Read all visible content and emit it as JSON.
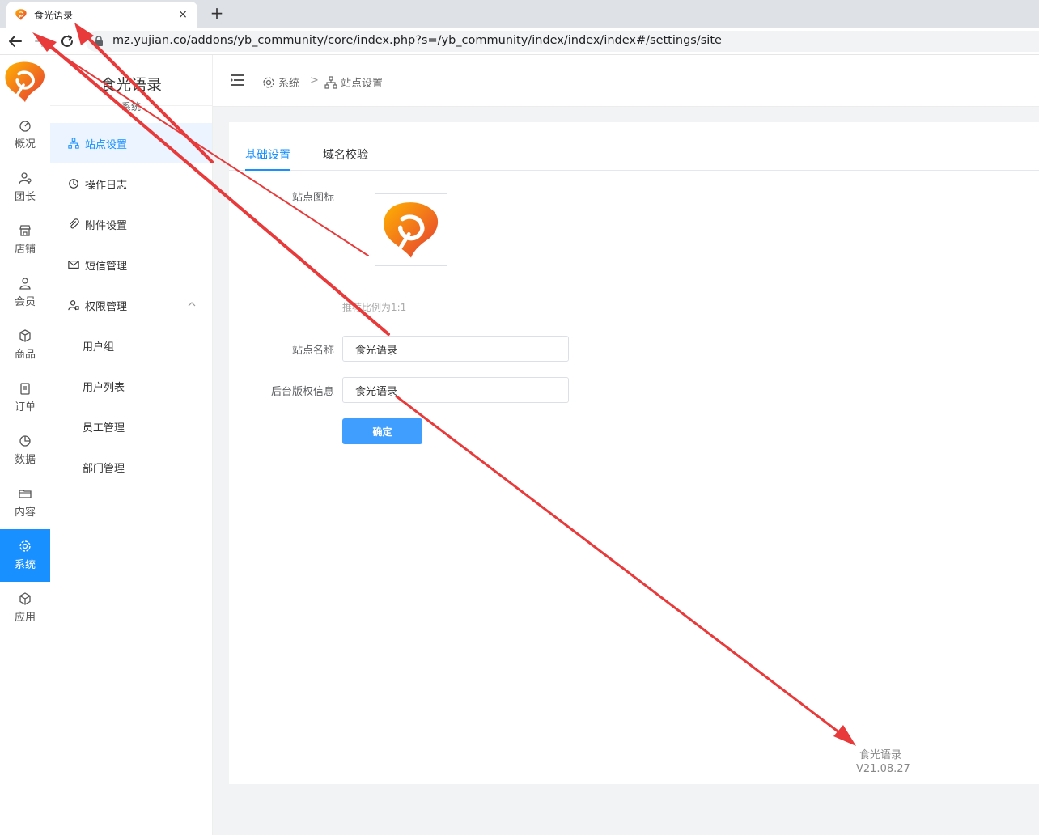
{
  "browser": {
    "tab_title": "食光语录",
    "new_tab": "+",
    "close": "×",
    "url": "mz.yujian.co/addons/yb_community/core/index.php?s=/yb_community/index/index/index#/settings/site"
  },
  "rail": {
    "items": [
      {
        "label": "概况",
        "icon": "dashboard-icon"
      },
      {
        "label": "团长",
        "icon": "user-star-icon"
      },
      {
        "label": "店铺",
        "icon": "shop-icon"
      },
      {
        "label": "会员",
        "icon": "user-icon"
      },
      {
        "label": "商品",
        "icon": "box-icon"
      },
      {
        "label": "订单",
        "icon": "clipboard-icon"
      },
      {
        "label": "数据",
        "icon": "pie-chart-icon"
      },
      {
        "label": "内容",
        "icon": "folder-icon"
      },
      {
        "label": "系统",
        "icon": "gear-icon",
        "active": true
      },
      {
        "label": "应用",
        "icon": "cube-icon"
      }
    ]
  },
  "submenu": {
    "title": "食光语录",
    "subtitle": "系统",
    "items": [
      {
        "label": "站点设置",
        "icon": "sitemap-icon",
        "active": true
      },
      {
        "label": "操作日志",
        "icon": "history-icon"
      },
      {
        "label": "附件设置",
        "icon": "paperclip-icon"
      },
      {
        "label": "短信管理",
        "icon": "mail-icon"
      },
      {
        "label": "权限管理",
        "icon": "user-lock-icon",
        "expanded": true
      }
    ],
    "children": [
      "用户组",
      "用户列表",
      "员工管理",
      "部门管理"
    ]
  },
  "breadcrumb": {
    "root": "系统",
    "separator": ">",
    "current": "站点设置"
  },
  "tabs": [
    "基础设置",
    "域名校验"
  ],
  "form": {
    "icon_label": "站点图标",
    "icon_hint": "推荐比例为1:1",
    "name_label": "站点名称",
    "name_value": "食光语录",
    "copyright_label": "后台版权信息",
    "copyright_value": "食光语录",
    "submit_label": "确定"
  },
  "footer": {
    "name": "食光语录",
    "version": "V21.08.27"
  },
  "colors": {
    "accent": "#1890ff",
    "button": "#409eff",
    "annotation": "#e83a3a"
  }
}
